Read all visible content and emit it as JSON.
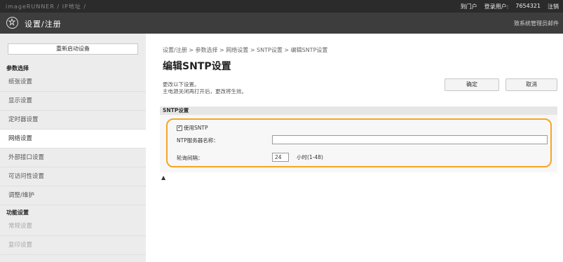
{
  "topbar": {
    "crumbs": "imageRUNNER  /  IP地址  /",
    "portal": "到门户",
    "login_user_label": "登录用户:",
    "login_user_value": "7654321",
    "logout": "注销"
  },
  "header": {
    "title": "设置/注册",
    "help_link": "致系统管理员邮件"
  },
  "sidebar": {
    "restart_button": "重新启动设备",
    "section_preferences": "参数选择",
    "items": [
      {
        "label": "纸张设置"
      },
      {
        "label": "显示设置"
      },
      {
        "label": "定时器设置"
      },
      {
        "label": "网络设置"
      },
      {
        "label": "外部接口设置"
      },
      {
        "label": "可访问性设置"
      },
      {
        "label": "调整/维护"
      }
    ],
    "section_function": "功能设置",
    "function_items": [
      {
        "label": "常规设置"
      },
      {
        "label": "复印设置"
      }
    ]
  },
  "main": {
    "breadcrumb": "设置/注册 > 参数选择 > 网络设置 > SNTP设置 > 编辑SNTP设置",
    "title": "编辑SNTP设置",
    "desc_line1": "更改以下设置。",
    "desc_line2": "主电源关闭再打开后，更改将生效。",
    "ok_button": "确定",
    "cancel_button": "取消",
    "section_title": "SNTP设置",
    "use_sntp_label": "使用SNTP",
    "use_sntp_checked": true,
    "server_name_label": "NTP服务器名称：",
    "server_name_value": "",
    "interval_label": "轮询间隔：",
    "interval_value": "24",
    "interval_unit": "小时(1-48)",
    "top_link": "▲"
  }
}
